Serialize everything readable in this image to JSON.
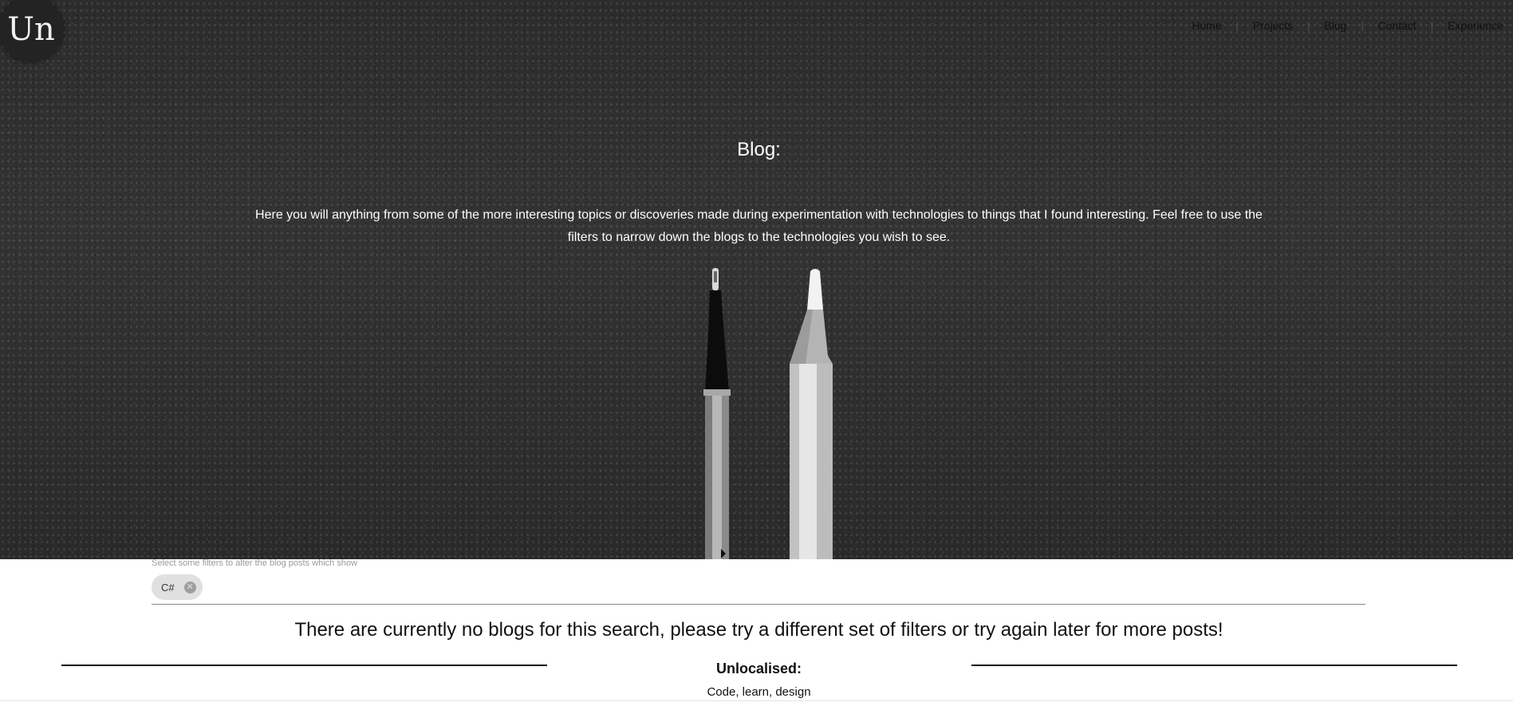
{
  "logo": {
    "text": "Un"
  },
  "nav": {
    "items": [
      "Home",
      "Projects",
      "Blog",
      "Contact",
      "Experience"
    ],
    "separator": "|"
  },
  "hero": {
    "title": "Blog:",
    "description": "Here you will anything from some of the more interesting topics or discoveries made during experimentation with technologies to things that I found interesting. Feel free to use the filters to narrow down the blogs to the technologies you wish to see."
  },
  "filters": {
    "hint": "Select some filters to alter the blog posts which show",
    "selected": [
      "C#"
    ],
    "chip_remove_icon": "close-circle-icon"
  },
  "results": {
    "empty_message": "There are currently no blogs for this search, please try a different set of filters or try again later for more posts!"
  },
  "footer": {
    "title": "Unlocalised:",
    "subtitle": "Code, learn, design"
  },
  "colors": {
    "hero_bg": "#2f2f2f",
    "chip_bg": "#e0e0e0",
    "text": "#111111"
  }
}
